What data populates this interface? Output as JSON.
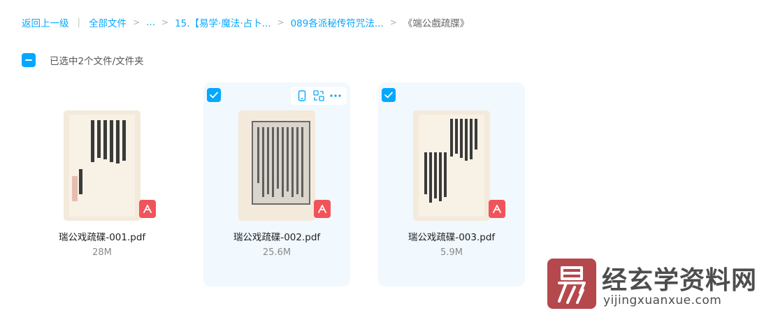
{
  "breadcrumb": {
    "back": "返回上一级",
    "all_files": "全部文件",
    "ellipsis": "...",
    "folder1": "15.【易学·魔法·占卜...",
    "folder2": "089各派秘传符咒法...",
    "current": "《端公戲疏牒》"
  },
  "selection": {
    "text": "已选中2个文件/文件夹"
  },
  "files": [
    {
      "name": "瑞公戏疏碟-001.pdf",
      "size": "28M",
      "selected": false,
      "type": "pdf"
    },
    {
      "name": "瑞公戏疏碟-002.pdf",
      "size": "25.6M",
      "selected": true,
      "type": "pdf"
    },
    {
      "name": "瑞公戏疏碟-003.pdf",
      "size": "5.9M",
      "selected": true,
      "type": "pdf"
    }
  ],
  "card_actions": [
    "phone-icon",
    "convert-icon",
    "more-icon"
  ],
  "watermark": {
    "logo_char": "易",
    "title": "经玄学资料网",
    "url": "yijingxuanxue.com"
  },
  "colors": {
    "accent": "#06a7ff",
    "selected_bg": "#f1f8fe",
    "pdf_red": "#f0545a"
  }
}
